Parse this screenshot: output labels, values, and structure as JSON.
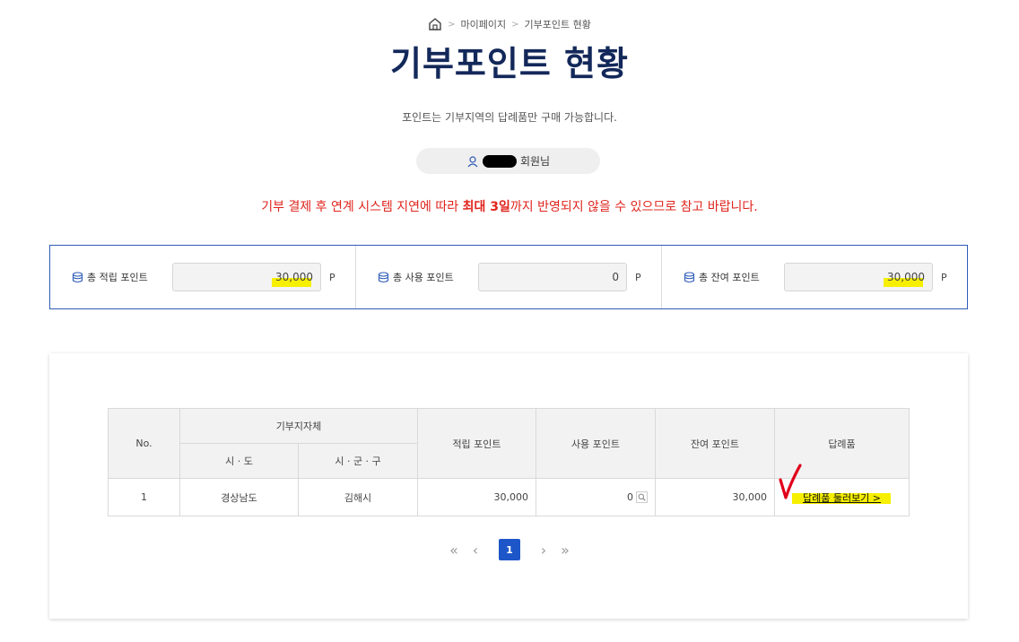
{
  "breadcrumb": {
    "home_icon": "home-icon",
    "items": [
      "마이페이지",
      "기부포인트 현황"
    ],
    "separator": ">"
  },
  "page_title": "기부포인트 현황",
  "subtitle": "포인트는 기부지역의 답례품만 구매 가능합니다.",
  "user": {
    "icon": "user-icon",
    "name_redacted": true,
    "suffix": "회원님"
  },
  "notice": {
    "before": "기부 결제 후 연계 시스템 지연에 따라 ",
    "bold": "최대 3일",
    "after": "까지 반영되지 않을 수 있으므로 참고 바랍니다."
  },
  "points": [
    {
      "label": "총 적립 포인트",
      "value": "30,000",
      "unit": "P",
      "icon": "database-icon",
      "highlighted": true
    },
    {
      "label": "총 사용 포인트",
      "value": "0",
      "unit": "P",
      "icon": "database-icon",
      "highlighted": false
    },
    {
      "label": "총 잔여 포인트",
      "value": "30,000",
      "unit": "P",
      "icon": "database-icon",
      "highlighted": true
    }
  ],
  "table": {
    "headers": {
      "no": "No.",
      "region_group": "기부지자체",
      "sido": "시 · 도",
      "sigungu": "시 · 군 · 구",
      "earned": "적립 포인트",
      "used": "사용 포인트",
      "remaining": "잔여 포인트",
      "gift": "답례품"
    },
    "rows": [
      {
        "no": "1",
        "sido": "경상남도",
        "sigungu": "김해시",
        "earned": "30,000",
        "used": "0",
        "remaining": "30,000",
        "gift_link": "답례품 둘러보기 >"
      }
    ]
  },
  "pagination": {
    "first": "«",
    "prev": "‹",
    "current": "1",
    "next": "›",
    "last": "»"
  },
  "colors": {
    "title": "#13285a",
    "notice": "#e0241d",
    "accent": "#1d56c9",
    "highlight": "#f6ef00",
    "annotation": "#e0001b"
  }
}
